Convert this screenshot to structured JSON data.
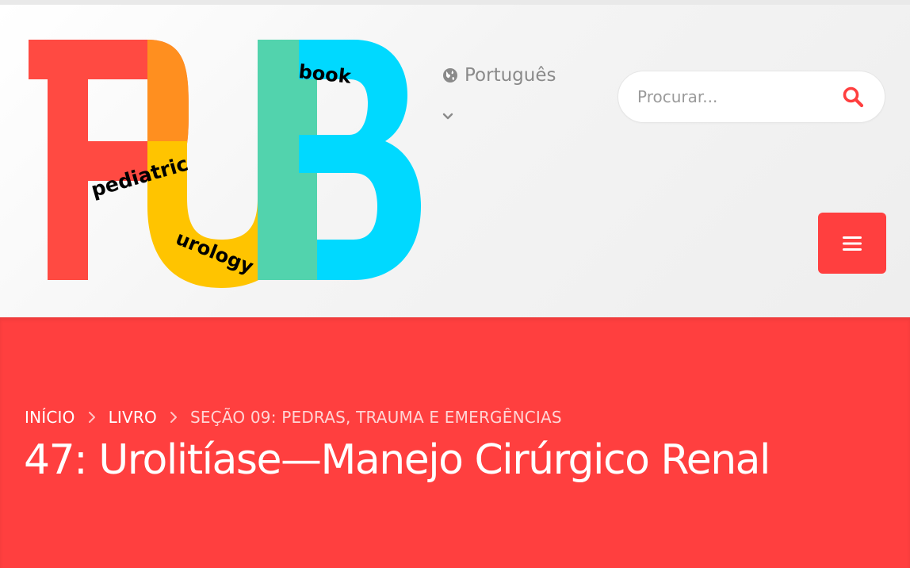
{
  "logo": {
    "main_letters": "PUB",
    "word_pediatric": "pediatric",
    "word_urology": "urology",
    "word_book": "book",
    "colors": {
      "red": "#ff4a42",
      "orange": "#ff8f1f",
      "yellow": "#ffc400",
      "green": "#52d3ad",
      "cyan": "#00d9ff"
    }
  },
  "header": {
    "language_label": "Português",
    "language_icon": "globe-icon",
    "language_dropdown_icon": "chevron-down-icon",
    "search_placeholder": "Procurar...",
    "search_icon": "search-icon",
    "menu_icon": "hamburger-menu-icon"
  },
  "breadcrumb": {
    "items": [
      "INÍCIO",
      "LIVRO",
      "SEÇÃO 09: PEDRAS, TRAUMA E EMERGÊNCIAS"
    ],
    "separator_icon": "chevron-right-icon"
  },
  "page": {
    "title": "47: Urolitíase—Manejo Cirúrgico Renal"
  },
  "colors": {
    "accent": "#ff3f3f",
    "muted_text": "#8a8a8a"
  }
}
